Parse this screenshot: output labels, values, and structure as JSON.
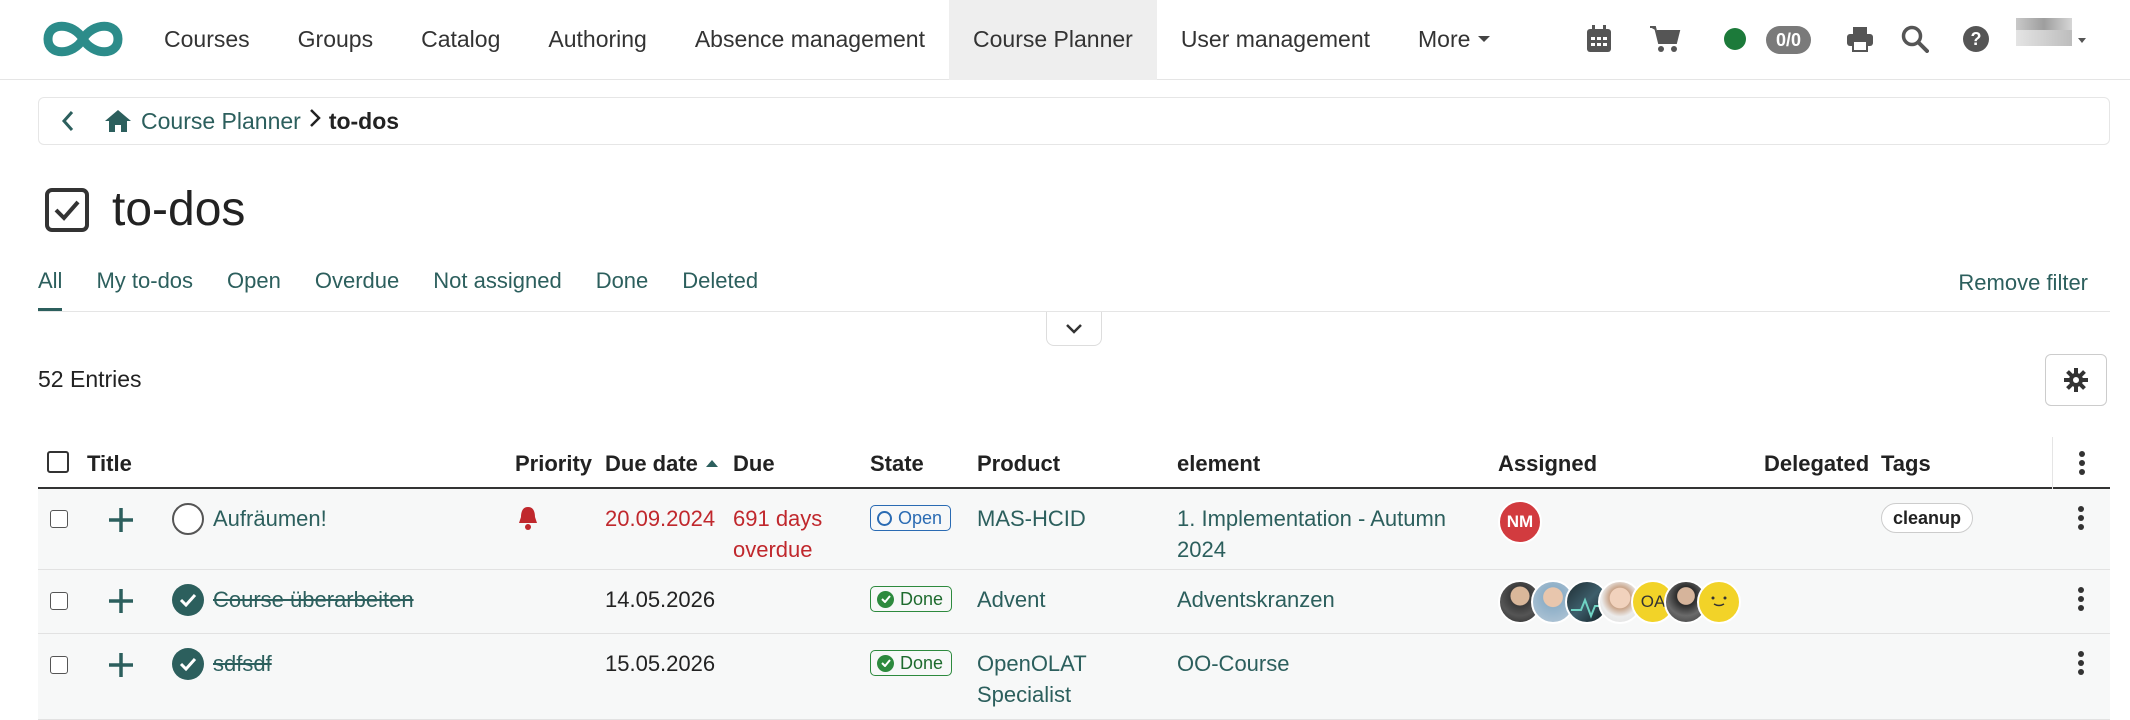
{
  "nav": {
    "items": [
      "Courses",
      "Groups",
      "Catalog",
      "Authoring",
      "Absence management",
      "Course Planner",
      "User management"
    ],
    "more_label": "More",
    "active": "Course Planner",
    "badge": "0/0",
    "icons": [
      "calendar-icon",
      "cart-icon",
      "status-dot",
      "print-icon",
      "search-icon",
      "help-icon",
      "avatar"
    ]
  },
  "breadcrumb": {
    "parent": "Course Planner",
    "current": "to-dos"
  },
  "page": {
    "title": "to-dos"
  },
  "tabs": [
    "All",
    "My to-dos",
    "Open",
    "Overdue",
    "Not assigned",
    "Done",
    "Deleted"
  ],
  "active_tab": "All",
  "remove_filter": "Remove filter",
  "entries": "52 Entries",
  "table": {
    "headers": {
      "title": "Title",
      "priority": "Priority",
      "due_date": "Due date",
      "due": "Due",
      "state": "State",
      "product": "Product",
      "element": "element",
      "assigned": "Assigned",
      "delegated": "Delegated",
      "tags": "Tags"
    },
    "rows": [
      {
        "title": "Aufräumen!",
        "due_date": "20.09.2024",
        "due_line1": "691 days",
        "due_line2": "overdue",
        "state": "Open",
        "product": "MAS-HCID",
        "element_line1": "1. Implementation - Autumn",
        "element_line2": "2024",
        "assigned": [
          "NM"
        ],
        "tag": "cleanup"
      },
      {
        "title": "Course überarbeiten",
        "due_date": "14.05.2026",
        "state": "Done",
        "product": "Advent",
        "element_line1": "Adventskranzen",
        "assigned": [
          "avatar-photo",
          "avatar-photo",
          "avatar-photo",
          "avatar-photo",
          "OA",
          "avatar-photo",
          "avatar-emoji"
        ]
      },
      {
        "title": "sdfsdf",
        "due_date": "15.05.2026",
        "state": "Done",
        "product_line1": "OpenOLAT",
        "product_line2": "Specialist",
        "element_line1": "OO-Course"
      }
    ]
  },
  "colors": {
    "accent": "#2c5f5d",
    "overdue": "#c0282d",
    "open": "#2a6bb3",
    "done": "#2d8a3e"
  }
}
